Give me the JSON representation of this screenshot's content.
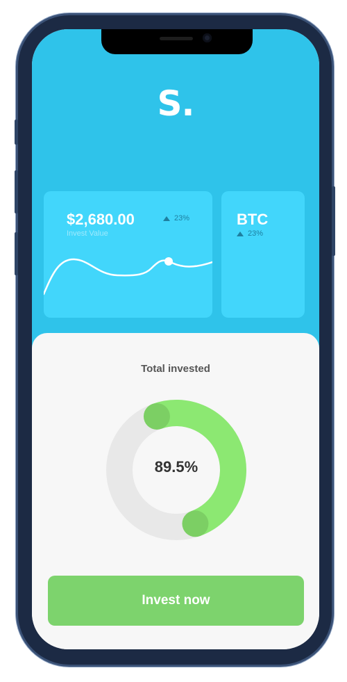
{
  "app": {
    "logo_text": "S."
  },
  "invest_card": {
    "value": "$2,680.00",
    "label": "Invest Value",
    "change": "23%",
    "change_direction": "up"
  },
  "btc_card": {
    "title": "BTC",
    "change": "23%",
    "change_direction": "up"
  },
  "total_invested": {
    "title": "Total invested",
    "percent_label": "89.5%",
    "percent_value": 0.895
  },
  "actions": {
    "invest_label": "Invest now"
  },
  "colors": {
    "brand_blue": "#2fc3ea",
    "card_blue": "#42d6fb",
    "accent_green": "#7dd36d",
    "ring_green": "#8ce872"
  }
}
